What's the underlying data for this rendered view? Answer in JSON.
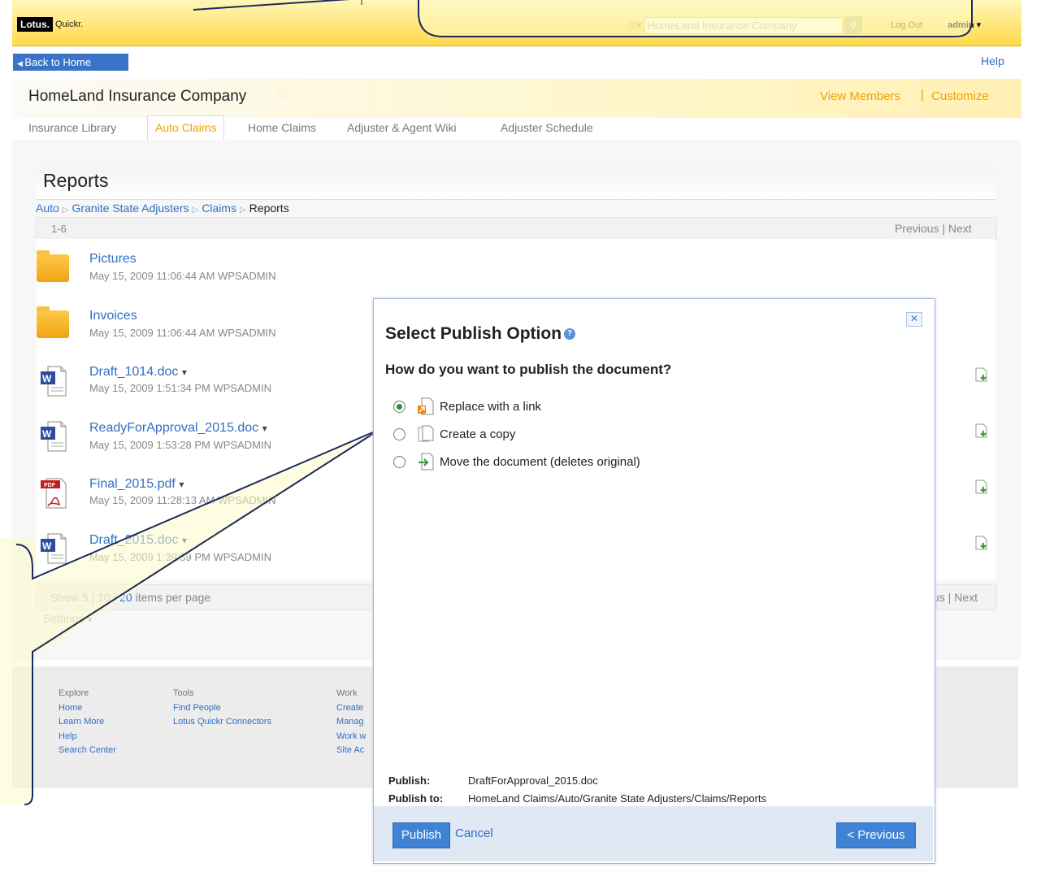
{
  "topbar": {
    "logo_brand": "Lotus.",
    "logo_product": "Quickr.",
    "search_value": "HomeLand Insurance Company",
    "logout_label": "Log Out",
    "user_name": "admin"
  },
  "nav": {
    "back_label": "Back to Home",
    "help_label": "Help"
  },
  "place": {
    "title": "HomeLand Insurance Company",
    "view_members": "View Members",
    "separator": "|",
    "customize": "Customize",
    "tabs": [
      {
        "label": "Insurance Library"
      },
      {
        "label": "Auto Claims"
      },
      {
        "label": "Home Claims"
      },
      {
        "label": "Adjuster & Agent Wiki"
      },
      {
        "label": "Adjuster Schedule"
      }
    ]
  },
  "reports": {
    "title": "Reports",
    "breadcrumb": [
      "Auto",
      "Granite State Adjusters",
      "Claims",
      "Reports"
    ],
    "range": "1-6",
    "pager": {
      "previous": "Previous",
      "sep": "|",
      "next": "Next"
    },
    "pager_bottom": "us | Next",
    "items": [
      {
        "name": "Pictures",
        "meta": "May 15, 2009 11:06:44 AM  WPSADMIN",
        "type": "folder-icon"
      },
      {
        "name": "Invoices",
        "meta": "May 15, 2009 11:06:44 AM  WPSADMIN",
        "type": "folder-icon"
      },
      {
        "name": "Draft_1014.doc",
        "meta": "May 15, 2009 1:51:34 PM  WPSADMIN",
        "type": "word-doc-icon"
      },
      {
        "name": "ReadyForApproval_2015.doc",
        "meta": "May 15, 2009 1:53:28 PM  WPSADMIN",
        "type": "word-doc-icon"
      },
      {
        "name": "Final_2015.pdf",
        "meta": "May 15, 2009 11:28:13 AM  WPSADMIN",
        "type": "pdf-icon"
      },
      {
        "name": "Draft_2015.doc",
        "meta": "May 15, 2009 1:39:59 PM  WPSADMIN",
        "type": "word-doc-icon"
      }
    ],
    "show": {
      "prefix": "Show",
      "n5": "5",
      "n10": "10",
      "n20": "20",
      "suffix": "items per page"
    },
    "settings_label": "Settings"
  },
  "footer": {
    "columns": [
      {
        "heading": "Explore",
        "links": [
          "Home",
          "Learn More",
          "Help",
          "Search Center"
        ]
      },
      {
        "heading": "Tools",
        "links": [
          "Find People",
          "Lotus Quickr Connectors"
        ]
      },
      {
        "heading": "Work",
        "links": [
          "Create",
          "Manag",
          "Work w",
          "Site Ac"
        ]
      }
    ]
  },
  "dialog": {
    "title": "Select Publish Option",
    "question": "How do you want to publish the document?",
    "options": [
      {
        "label": "Replace with a link",
        "selected": true
      },
      {
        "label": "Create a copy",
        "selected": false
      },
      {
        "label": "Move the document (deletes original)",
        "selected": false
      }
    ],
    "publish_key": "Publish:",
    "publish_value": "DraftForApproval_2015.doc",
    "publish_to_key": "Publish to:",
    "publish_to_value": "HomeLand Claims/Auto/Granite State Adjusters/Claims/Reports",
    "publish_button": "Publish",
    "cancel_link": "Cancel",
    "previous_button": "< Previous"
  },
  "colors": {
    "accent": "#3f83d6",
    "brand_yellow": "#ffd94a",
    "link": "#2f6fc4",
    "highlight": "#f0a000",
    "callout": "#fffbc8"
  }
}
